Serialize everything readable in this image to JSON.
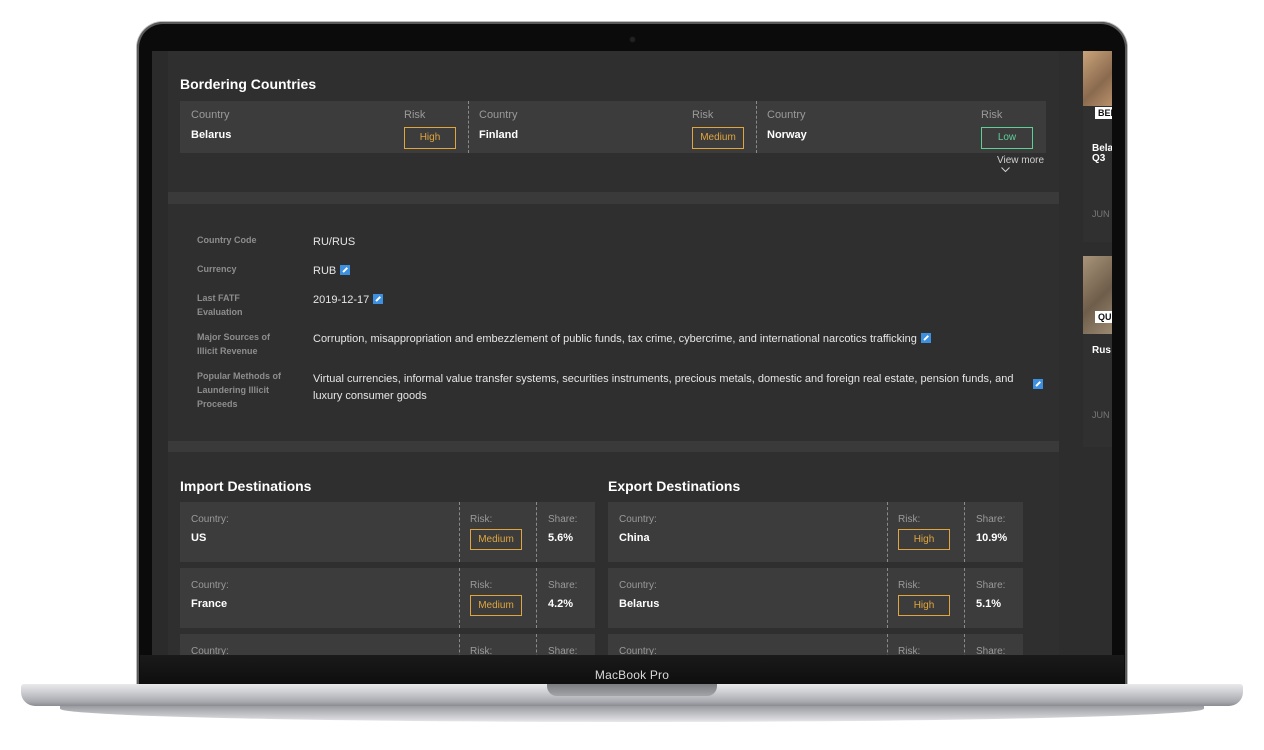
{
  "device": {
    "brand": "MacBook Pro"
  },
  "bordering": {
    "title": "Bordering Countries",
    "country_label": "Country",
    "risk_label": "Risk",
    "items": [
      {
        "country": "Belarus",
        "risk": "High"
      },
      {
        "country": "Finland",
        "risk": "Medium"
      },
      {
        "country": "Norway",
        "risk": "Low"
      }
    ],
    "view_more": "View more"
  },
  "info": [
    {
      "label": "Country Code",
      "value": "RU/RUS"
    },
    {
      "label": "Currency",
      "value": "RUB"
    },
    {
      "label": "Last FATF Evaluation",
      "value": "2019-12-17"
    },
    {
      "label": "Major Sources of Illicit Revenue",
      "value": "Corruption, misappropriation and embezzlement of public funds, tax crime, cybercrime, and international narcotics trafficking"
    },
    {
      "label": "Popular Methods of Laundering Illicit Proceeds",
      "value": "Virtual currencies, informal value transfer systems, securities instruments, precious metals, domestic and foreign real estate, pension funds, and luxury consumer goods"
    }
  ],
  "imports": {
    "title": "Import Destinations",
    "country_label": "Country:",
    "risk_label": "Risk:",
    "share_label": "Share:",
    "items": [
      {
        "country": "US",
        "risk": "Medium",
        "share": "5.6%"
      },
      {
        "country": "France",
        "risk": "Medium",
        "share": "4.2%"
      }
    ]
  },
  "exports": {
    "title": "Export Destinations",
    "country_label": "Country:",
    "risk_label": "Risk:",
    "share_label": "Share:",
    "items": [
      {
        "country": "China",
        "risk": "High",
        "share": "10.9%"
      },
      {
        "country": "Belarus",
        "risk": "High",
        "share": "5.1%"
      }
    ]
  },
  "sidebar": {
    "cards": [
      {
        "tag": "BEl",
        "title_l1": "Bela",
        "title_l2": "Q3",
        "date": "JUN"
      },
      {
        "tag": "QU",
        "title_l1": "Rus",
        "title_l2": "",
        "date": "JUN"
      }
    ]
  },
  "colors": {
    "high": "#e0a53e",
    "medium": "#e0a53e",
    "low": "#5fcf9a",
    "link": "#3d8fe0"
  }
}
